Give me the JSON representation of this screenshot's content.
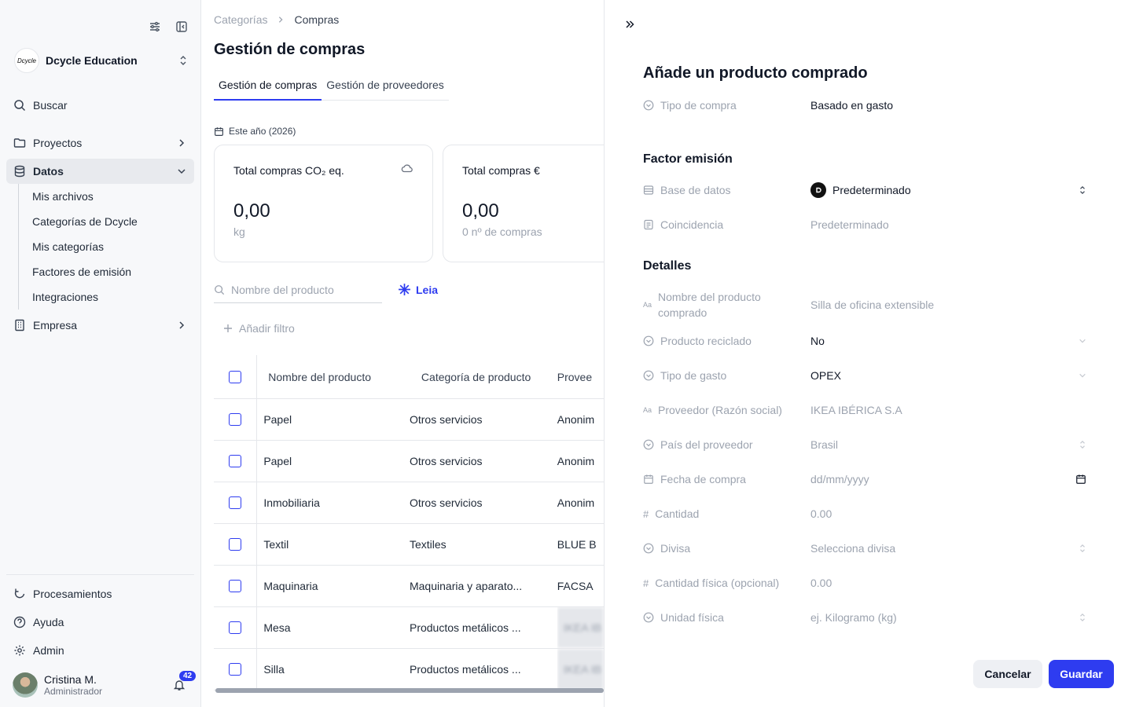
{
  "sidebar": {
    "org_logo_text": "Dcycle",
    "org_name": "Dcycle Education",
    "search_label": "Buscar",
    "nav": [
      {
        "label": "Proyectos",
        "icon": "folder-icon"
      },
      {
        "label": "Datos",
        "icon": "database-icon"
      },
      {
        "label": "Empresa",
        "icon": "building-icon"
      }
    ],
    "sub_items": [
      "Mis archivos",
      "Categorías de Dcycle",
      "Mis categorías",
      "Factores de emisión",
      "Integraciones"
    ],
    "bottom": [
      {
        "label": "Procesamientos",
        "icon": "refresh-icon"
      },
      {
        "label": "Ayuda",
        "icon": "help-icon"
      },
      {
        "label": "Admin",
        "icon": "gear-icon"
      }
    ],
    "user": {
      "name": "Cristina M.",
      "role": "Administrador",
      "notifications": "42"
    }
  },
  "main": {
    "breadcrumb": [
      "Categorías",
      "Compras"
    ],
    "title": "Gestión de compras",
    "tabs": [
      "Gestión de compras",
      "Gestión de proveedores"
    ],
    "period": "Este año (2026)",
    "cards": [
      {
        "title": "Total compras CO₂ eq.",
        "value": "0,00",
        "sub": "kg"
      },
      {
        "title": "Total compras €",
        "value": "0,00",
        "sub": "0 nº de compras"
      }
    ],
    "search_placeholder": "Nombre del producto",
    "leia_label": "Leia",
    "add_filter": "Añadir filtro",
    "columns": [
      "Nombre del producto",
      "Categoría de producto",
      "Provee"
    ],
    "rows": [
      {
        "name": "Papel",
        "category": "Otros servicios",
        "provider": "Anonim"
      },
      {
        "name": "Papel",
        "category": "Otros servicios",
        "provider": "Anonim"
      },
      {
        "name": "Inmobiliaria",
        "category": "Otros servicios",
        "provider": "Anonim"
      },
      {
        "name": "Textil",
        "category": "Textiles",
        "provider": "BLUE B"
      },
      {
        "name": "Maquinaria",
        "category": "Maquinaria y aparato...",
        "provider": "FACSA"
      },
      {
        "name": "Mesa",
        "category": "Productos metálicos ...",
        "provider": "IKEA IB"
      },
      {
        "name": "Silla",
        "category": "Productos metálicos ...",
        "provider": "IKEA IB"
      }
    ]
  },
  "panel": {
    "title": "Añade un producto comprado",
    "purchase_type": {
      "label": "Tipo de compra",
      "value": "Basado en gasto"
    },
    "emission_heading": "Factor emisión",
    "database": {
      "label": "Base de datos",
      "value": "Predeterminado"
    },
    "match": {
      "label": "Coincidencia",
      "value": "Predeterminado"
    },
    "details_heading": "Detalles",
    "fields": {
      "product_name": {
        "label": "Nombre del producto comprado",
        "placeholder": "Silla de oficina extensible"
      },
      "recycled": {
        "label": "Producto reciclado",
        "value": "No"
      },
      "expense_type": {
        "label": "Tipo de gasto",
        "value": "OPEX"
      },
      "supplier": {
        "label": "Proveedor (Razón social)",
        "value": "IKEA IBÉRICA S.A"
      },
      "supplier_country": {
        "label": "País del proveedor",
        "value": "Brasil"
      },
      "purchase_date": {
        "label": "Fecha de compra",
        "placeholder": "dd/mm/yyyy"
      },
      "quantity": {
        "label": "Cantidad",
        "placeholder": "0.00"
      },
      "currency": {
        "label": "Divisa",
        "placeholder": "Selecciona divisa"
      },
      "physical_quantity": {
        "label": "Cantidad física (opcional)",
        "placeholder": "0.00"
      },
      "physical_unit": {
        "label": "Unidad física",
        "placeholder": "ej. Kilogramo (kg)"
      }
    },
    "cancel": "Cancelar",
    "save": "Guardar"
  },
  "colors": {
    "accent": "#2e3cf0",
    "muted": "#9ca3af"
  }
}
